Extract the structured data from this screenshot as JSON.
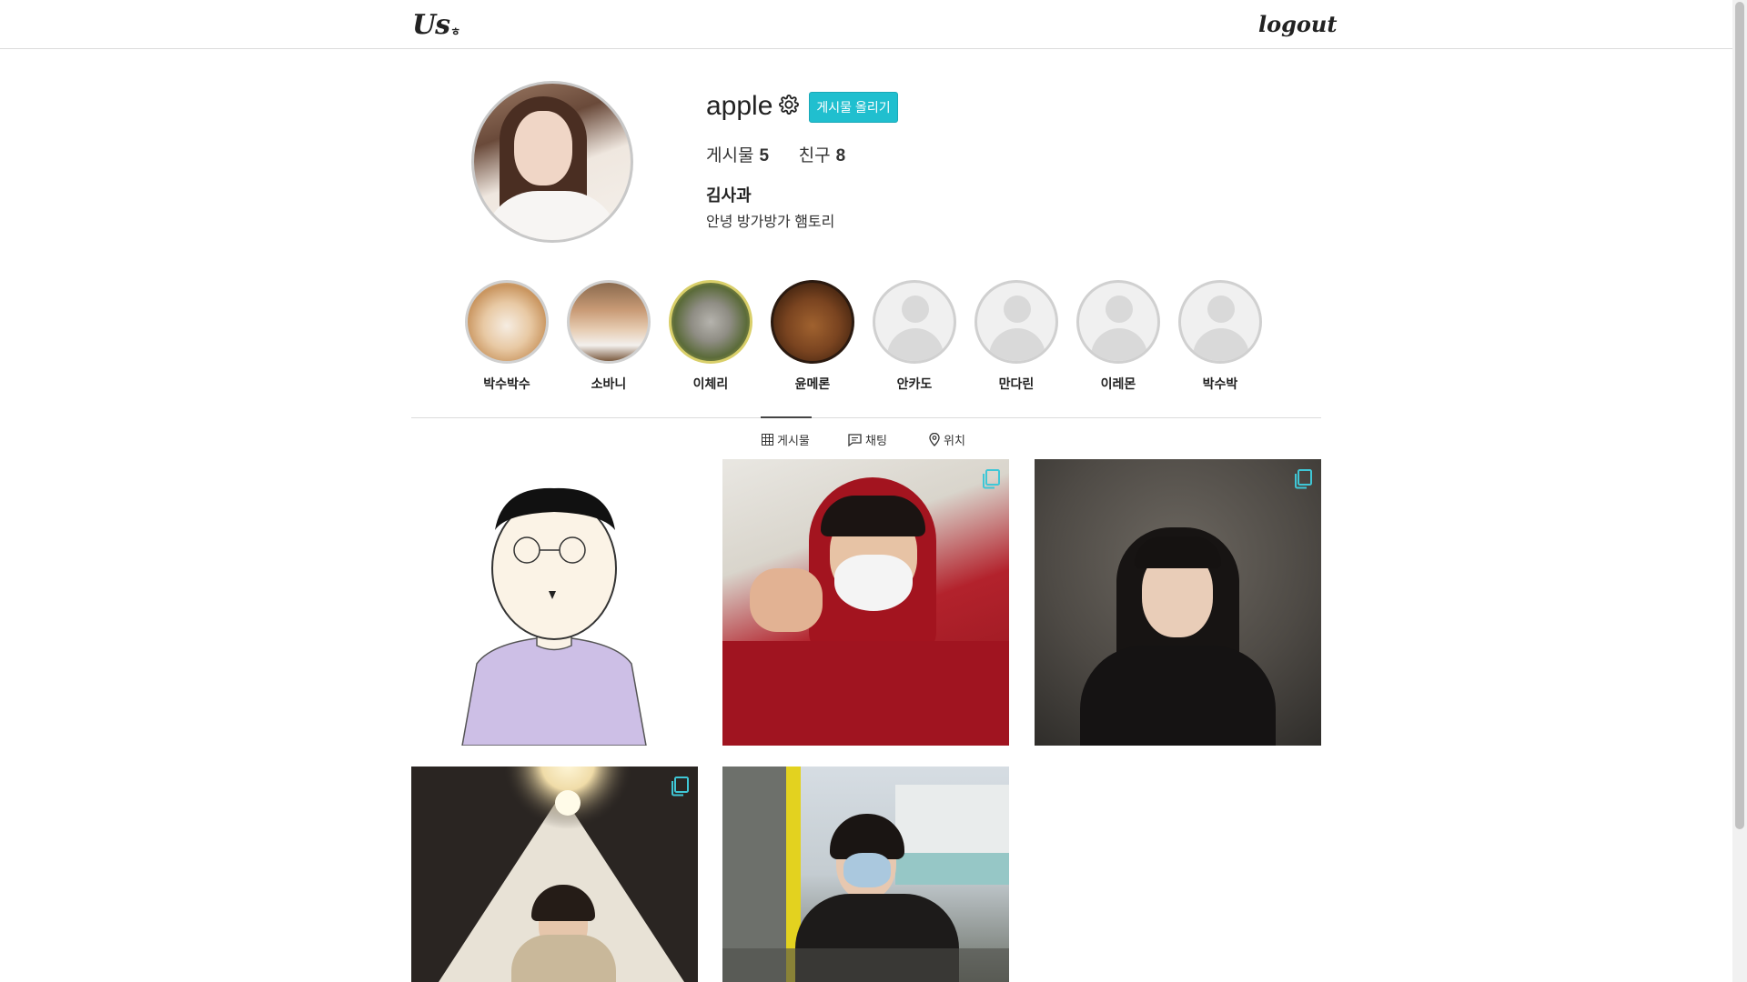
{
  "app": {
    "logo": "Us",
    "logo_suffix": "ㅎ",
    "logout_label": "logout"
  },
  "profile": {
    "username": "apple",
    "post_button": "게시물 올리기",
    "posts_label": "게시물",
    "posts_count": "5",
    "friends_label": "친구",
    "friends_count": "8",
    "real_name": "김사과",
    "bio": "안녕 방가방가 햄토리"
  },
  "friends": [
    {
      "name": "박수박수",
      "avatar": "cat-photo"
    },
    {
      "name": "소바니",
      "avatar": "hamster-photo"
    },
    {
      "name": "이체리",
      "avatar": "koala-photo"
    },
    {
      "name": "윤메론",
      "avatar": "dog-photo"
    },
    {
      "name": "안카도",
      "avatar": "default-avatar"
    },
    {
      "name": "만다린",
      "avatar": "default-avatar"
    },
    {
      "name": "이레몬",
      "avatar": "default-avatar"
    },
    {
      "name": "박수박",
      "avatar": "default-avatar"
    }
  ],
  "tabs": [
    {
      "label": "게시물",
      "icon": "grid-icon",
      "active": true
    },
    {
      "label": "채팅",
      "icon": "chat-icon",
      "active": false
    },
    {
      "label": "위치",
      "icon": "location-icon",
      "active": false
    }
  ],
  "colors": {
    "accent": "#20bfcf",
    "multi_icon": "#3fc7d6"
  }
}
